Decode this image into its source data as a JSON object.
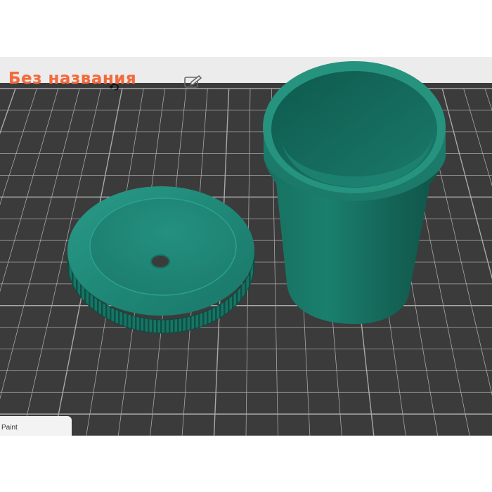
{
  "project": {
    "title": "Без названия",
    "rename_icon": "pencil-edit-icon"
  },
  "viewport": {
    "background_color": "#3b3b3b",
    "grid_color": "#a8a8a8",
    "strip_color": "#ececec",
    "objects": [
      {
        "name": "lid",
        "color": "#1f8877"
      },
      {
        "name": "cup",
        "color": "#166a5d"
      }
    ]
  },
  "bottom_panel": {
    "label": "Paint"
  },
  "colors": {
    "title": "#f26a3d",
    "model": "#1f8877"
  }
}
